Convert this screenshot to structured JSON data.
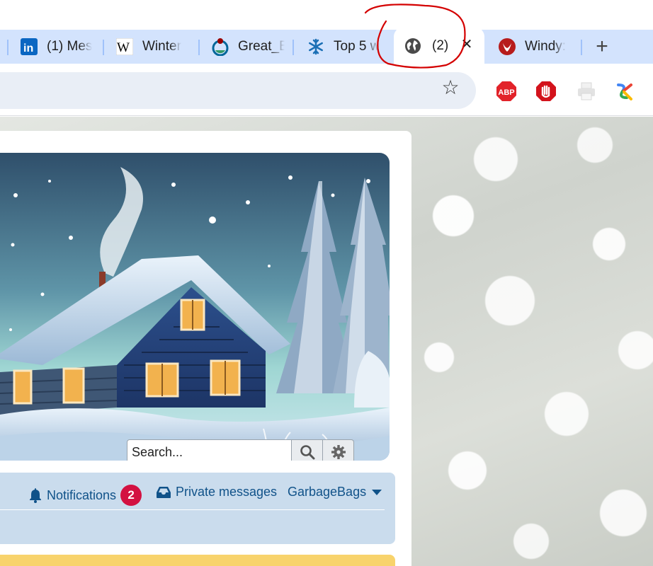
{
  "browser": {
    "tabs": [
      {
        "label": "(1) Mes",
        "icon": "linkedin-icon"
      },
      {
        "label": "Winter",
        "icon": "wikipedia-icon"
      },
      {
        "label": "Great_B",
        "icon": "wikimedia-commons-icon"
      },
      {
        "label": "Top 5 w",
        "icon": "snowflake-icon"
      },
      {
        "label": "(2)",
        "icon": "globe-icon",
        "active": true
      },
      {
        "label": "Windy:",
        "icon": "windy-icon"
      }
    ],
    "new_tab_label": "+",
    "close_label": "✕"
  },
  "toolbar": {
    "extensions": [
      {
        "name": "adblock-plus-icon",
        "text": "ABP"
      },
      {
        "name": "stop-hand-icon"
      },
      {
        "name": "printer-icon"
      },
      {
        "name": "multicolor-extension-icon"
      }
    ]
  },
  "forum": {
    "search": {
      "placeholder": "Search..."
    },
    "nav": {
      "notifications_label": "Notifications",
      "notifications_count": "2",
      "messages_label": "Private messages",
      "username": "GarbageBags"
    }
  },
  "colors": {
    "tab_strip": "#d3e3fd",
    "nav_bar": "#cadced",
    "nav_link": "#105289",
    "badge": "#d31141",
    "notice_bar": "#f8d36c",
    "annotation": "#d40000"
  }
}
